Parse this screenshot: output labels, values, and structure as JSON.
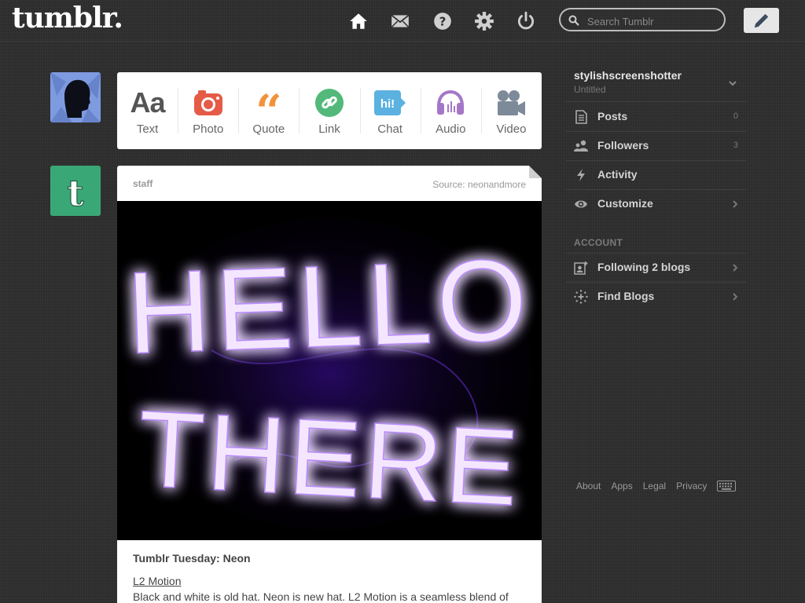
{
  "header": {
    "logo": "tumblr.",
    "search_placeholder": "Search Tumblr",
    "nav_icons": [
      "home-icon",
      "mail-icon",
      "help-icon",
      "gear-icon",
      "power-icon"
    ],
    "compose_icon": "pencil-icon"
  },
  "post_types": [
    {
      "label": "Text",
      "icon": "text-icon",
      "color": "#555555"
    },
    {
      "label": "Photo",
      "icon": "camera-icon",
      "color": "#e55b47"
    },
    {
      "label": "Quote",
      "icon": "quote-icon",
      "color": "#f3923a"
    },
    {
      "label": "Link",
      "icon": "link-icon",
      "color": "#52b97a"
    },
    {
      "label": "Chat",
      "icon": "chat-icon",
      "color": "#5bb1e0"
    },
    {
      "label": "Audio",
      "icon": "headphones-icon",
      "color": "#a576c7"
    },
    {
      "label": "Video",
      "icon": "video-camera-icon",
      "color": "#7d8a99"
    }
  ],
  "post": {
    "author": "staff",
    "source": "Source: neonandmore",
    "image_text_line1": "HELLO",
    "image_text_line2": "THERE",
    "neon_color": "#a766ff",
    "title": "Tumblr Tuesday: Neon",
    "link_text": "L2 Motion",
    "body": "Black and white is old hat. Neon is new hat. L2 Motion is a seamless blend of"
  },
  "sidebar": {
    "blog_name": "stylishscreenshotter",
    "blog_subtitle": "Untitled",
    "items": [
      {
        "label": "Posts",
        "count": "0",
        "icon": "posts-icon"
      },
      {
        "label": "Followers",
        "count": "3",
        "icon": "followers-icon"
      },
      {
        "label": "Activity",
        "count": "",
        "icon": "activity-icon"
      },
      {
        "label": "Customize",
        "count": "",
        "icon": "eye-icon"
      }
    ],
    "account_header": "ACCOUNT",
    "account_items": [
      {
        "label": "Following 2 blogs",
        "icon": "following-icon"
      },
      {
        "label": "Find Blogs",
        "icon": "find-blogs-icon"
      }
    ],
    "footer": {
      "about": "About",
      "apps": "Apps",
      "legal": "Legal",
      "privacy": "Privacy"
    }
  },
  "colors": {
    "background": "#2f2f2f",
    "staff_avatar": "#3aa876",
    "user_avatar": "#6f8fd6"
  }
}
